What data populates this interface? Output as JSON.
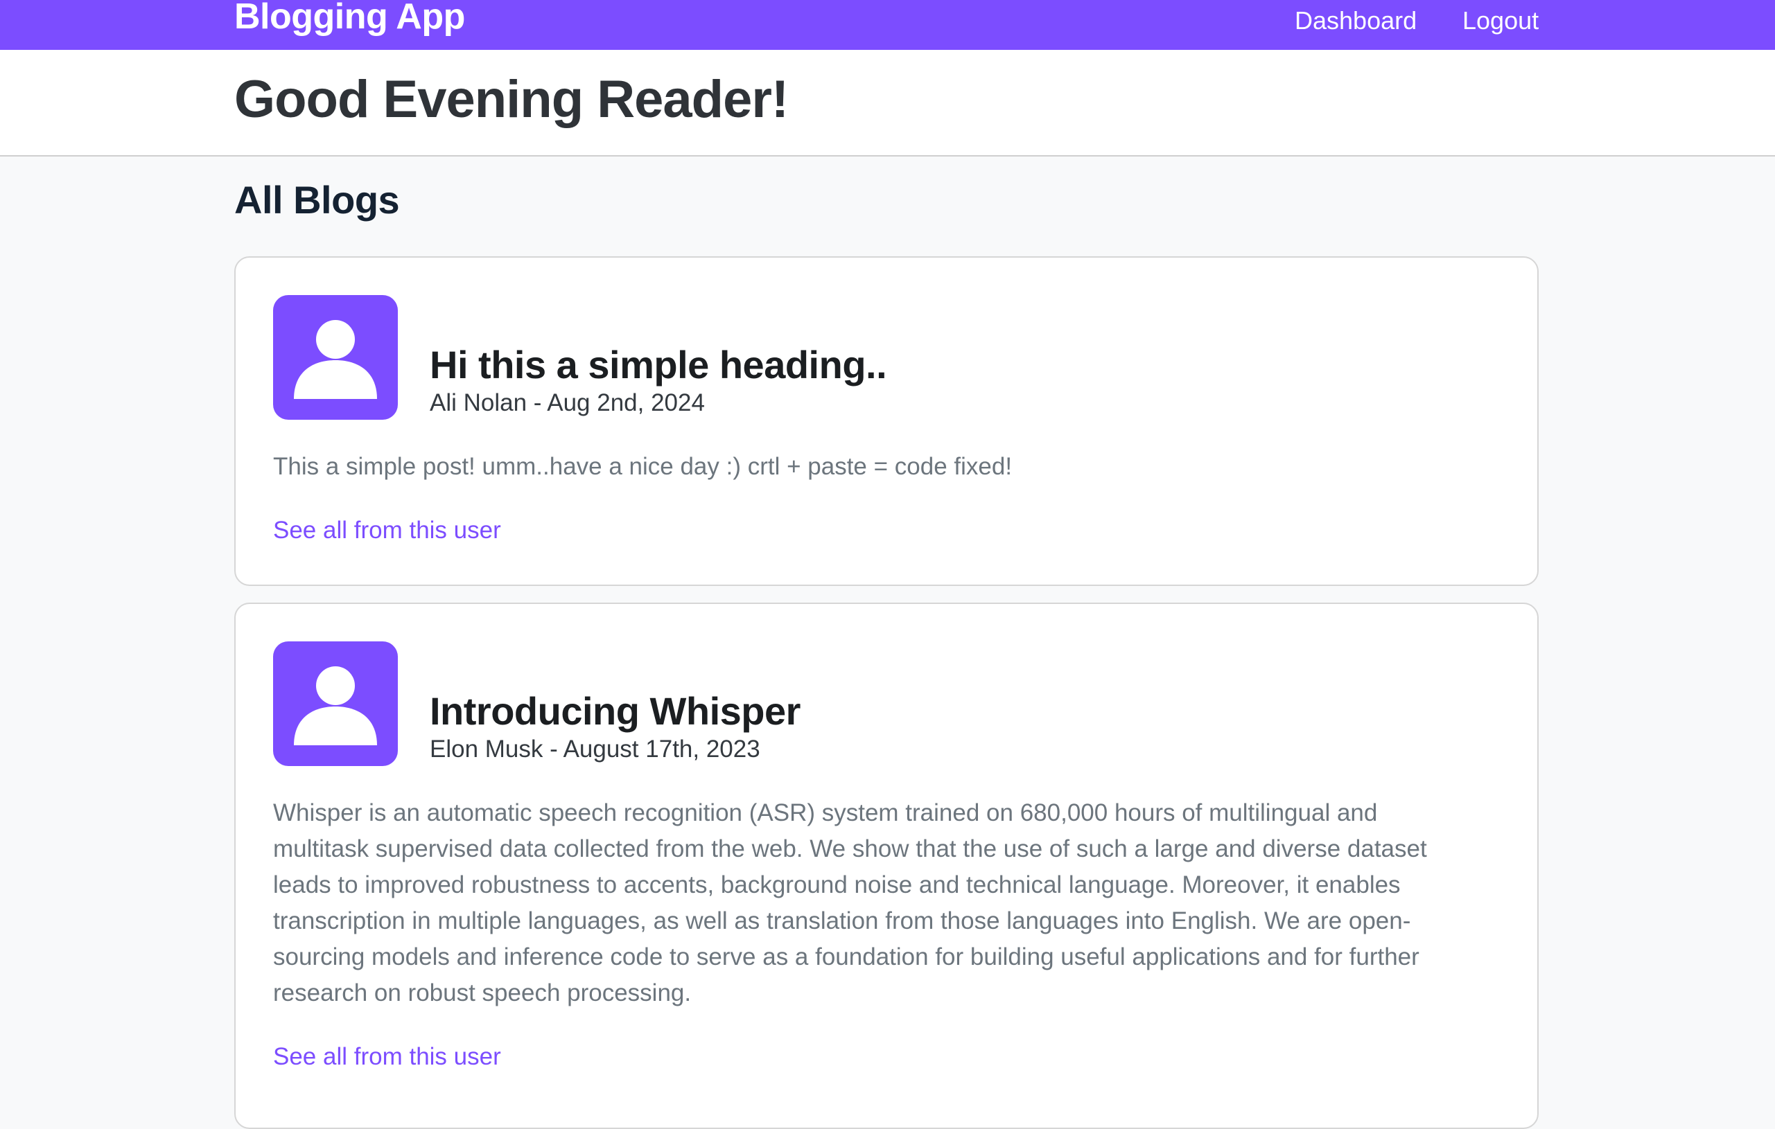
{
  "navbar": {
    "brand": "Blogging App",
    "links": [
      "Dashboard",
      "Logout"
    ],
    "background_color": "#7c4dff"
  },
  "header": {
    "greeting": "Good Evening Reader!"
  },
  "main": {
    "section_title": "All Blogs",
    "posts": [
      {
        "avatar_icon": "user-icon",
        "title": "Hi this a simple heading..",
        "meta": "Ali Nolan - Aug 2nd, 2024",
        "body": "This a simple post! umm..have a nice day :) crtl + paste = code fixed!",
        "link_label": "See all from this user"
      },
      {
        "avatar_icon": "user-icon",
        "title": "Introducing Whisper",
        "meta": "Elon Musk - August 17th, 2023",
        "body": "Whisper is an automatic speech recognition (ASR) system trained on 680,000 hours of multilingual and multitask supervised data collected from the web. We show that the use of such a large and diverse dataset leads to improved robustness to accents, background noise and technical language. Moreover, it enables transcription in multiple languages, as well as translation from those languages into English. We are open-sourcing models and inference code to serve as a foundation for building useful applications and for further research on robust speech processing.",
        "link_label": "See all from this user"
      }
    ]
  },
  "colors": {
    "accent": "#7c4dff",
    "page_background": "#f8f9fa",
    "muted_text": "#6c757d"
  }
}
